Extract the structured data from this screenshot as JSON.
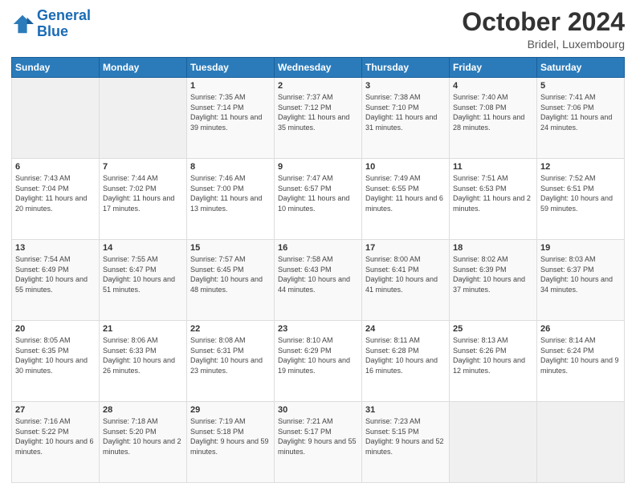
{
  "header": {
    "logo_line1": "General",
    "logo_line2": "Blue",
    "title": "October 2024",
    "subtitle": "Bridel, Luxembourg"
  },
  "days_of_week": [
    "Sunday",
    "Monday",
    "Tuesday",
    "Wednesday",
    "Thursday",
    "Friday",
    "Saturday"
  ],
  "weeks": [
    [
      {
        "day": "",
        "info": ""
      },
      {
        "day": "",
        "info": ""
      },
      {
        "day": "1",
        "info": "Sunrise: 7:35 AM\nSunset: 7:14 PM\nDaylight: 11 hours and 39 minutes."
      },
      {
        "day": "2",
        "info": "Sunrise: 7:37 AM\nSunset: 7:12 PM\nDaylight: 11 hours and 35 minutes."
      },
      {
        "day": "3",
        "info": "Sunrise: 7:38 AM\nSunset: 7:10 PM\nDaylight: 11 hours and 31 minutes."
      },
      {
        "day": "4",
        "info": "Sunrise: 7:40 AM\nSunset: 7:08 PM\nDaylight: 11 hours and 28 minutes."
      },
      {
        "day": "5",
        "info": "Sunrise: 7:41 AM\nSunset: 7:06 PM\nDaylight: 11 hours and 24 minutes."
      }
    ],
    [
      {
        "day": "6",
        "info": "Sunrise: 7:43 AM\nSunset: 7:04 PM\nDaylight: 11 hours and 20 minutes."
      },
      {
        "day": "7",
        "info": "Sunrise: 7:44 AM\nSunset: 7:02 PM\nDaylight: 11 hours and 17 minutes."
      },
      {
        "day": "8",
        "info": "Sunrise: 7:46 AM\nSunset: 7:00 PM\nDaylight: 11 hours and 13 minutes."
      },
      {
        "day": "9",
        "info": "Sunrise: 7:47 AM\nSunset: 6:57 PM\nDaylight: 11 hours and 10 minutes."
      },
      {
        "day": "10",
        "info": "Sunrise: 7:49 AM\nSunset: 6:55 PM\nDaylight: 11 hours and 6 minutes."
      },
      {
        "day": "11",
        "info": "Sunrise: 7:51 AM\nSunset: 6:53 PM\nDaylight: 11 hours and 2 minutes."
      },
      {
        "day": "12",
        "info": "Sunrise: 7:52 AM\nSunset: 6:51 PM\nDaylight: 10 hours and 59 minutes."
      }
    ],
    [
      {
        "day": "13",
        "info": "Sunrise: 7:54 AM\nSunset: 6:49 PM\nDaylight: 10 hours and 55 minutes."
      },
      {
        "day": "14",
        "info": "Sunrise: 7:55 AM\nSunset: 6:47 PM\nDaylight: 10 hours and 51 minutes."
      },
      {
        "day": "15",
        "info": "Sunrise: 7:57 AM\nSunset: 6:45 PM\nDaylight: 10 hours and 48 minutes."
      },
      {
        "day": "16",
        "info": "Sunrise: 7:58 AM\nSunset: 6:43 PM\nDaylight: 10 hours and 44 minutes."
      },
      {
        "day": "17",
        "info": "Sunrise: 8:00 AM\nSunset: 6:41 PM\nDaylight: 10 hours and 41 minutes."
      },
      {
        "day": "18",
        "info": "Sunrise: 8:02 AM\nSunset: 6:39 PM\nDaylight: 10 hours and 37 minutes."
      },
      {
        "day": "19",
        "info": "Sunrise: 8:03 AM\nSunset: 6:37 PM\nDaylight: 10 hours and 34 minutes."
      }
    ],
    [
      {
        "day": "20",
        "info": "Sunrise: 8:05 AM\nSunset: 6:35 PM\nDaylight: 10 hours and 30 minutes."
      },
      {
        "day": "21",
        "info": "Sunrise: 8:06 AM\nSunset: 6:33 PM\nDaylight: 10 hours and 26 minutes."
      },
      {
        "day": "22",
        "info": "Sunrise: 8:08 AM\nSunset: 6:31 PM\nDaylight: 10 hours and 23 minutes."
      },
      {
        "day": "23",
        "info": "Sunrise: 8:10 AM\nSunset: 6:29 PM\nDaylight: 10 hours and 19 minutes."
      },
      {
        "day": "24",
        "info": "Sunrise: 8:11 AM\nSunset: 6:28 PM\nDaylight: 10 hours and 16 minutes."
      },
      {
        "day": "25",
        "info": "Sunrise: 8:13 AM\nSunset: 6:26 PM\nDaylight: 10 hours and 12 minutes."
      },
      {
        "day": "26",
        "info": "Sunrise: 8:14 AM\nSunset: 6:24 PM\nDaylight: 10 hours and 9 minutes."
      }
    ],
    [
      {
        "day": "27",
        "info": "Sunrise: 7:16 AM\nSunset: 5:22 PM\nDaylight: 10 hours and 6 minutes."
      },
      {
        "day": "28",
        "info": "Sunrise: 7:18 AM\nSunset: 5:20 PM\nDaylight: 10 hours and 2 minutes."
      },
      {
        "day": "29",
        "info": "Sunrise: 7:19 AM\nSunset: 5:18 PM\nDaylight: 9 hours and 59 minutes."
      },
      {
        "day": "30",
        "info": "Sunrise: 7:21 AM\nSunset: 5:17 PM\nDaylight: 9 hours and 55 minutes."
      },
      {
        "day": "31",
        "info": "Sunrise: 7:23 AM\nSunset: 5:15 PM\nDaylight: 9 hours and 52 minutes."
      },
      {
        "day": "",
        "info": ""
      },
      {
        "day": "",
        "info": ""
      }
    ]
  ]
}
